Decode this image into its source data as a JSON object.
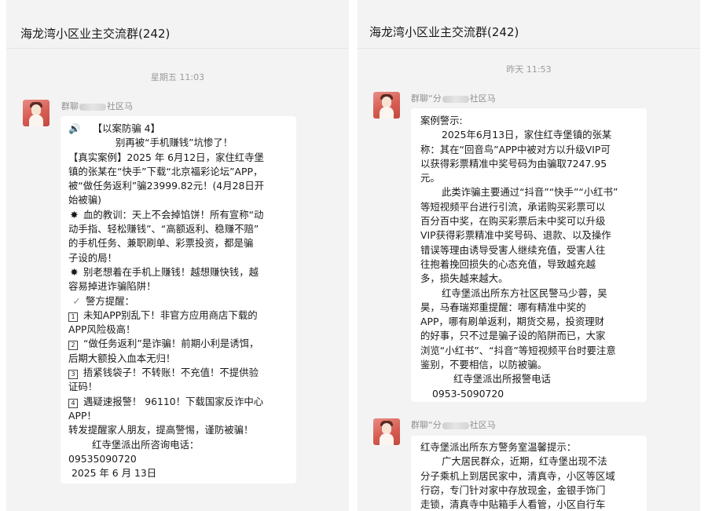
{
  "left": {
    "chat_title": "海龙湾小区业主交流群(242)",
    "timestamp": "星期五 11:03",
    "sender": {
      "prefix": "群聊",
      "suffix": "社区马"
    },
    "icons": {
      "speaker": "🔊",
      "virus": "✸",
      "check": "✓"
    },
    "message": {
      "l1": "【以案防骗 4】",
      "l2": "别再被“手机赚钱”坑惨了！",
      "l3": "【真实案例】2025 年 6月12日，家住红寺堡",
      "l4": "镇的张某在“快手”下载“北京福彩论坛”APP，",
      "l5": "被“做任务返利”骗23999.82元！(4月28日开",
      "l6": "始被骗)",
      "l7": "血的教训：天上不会掉馅饼！所有宣称“动",
      "l8": "动手指、轻松赚钱”、“高额返利、稳赚不赔”",
      "l9": "的手机任务、兼职刷单、彩票投资，都是骗",
      "l10": "子设的局！",
      "l11": "别老想着在手机上赚钱！越想赚快钱，越",
      "l12": "容易掉进诈骗陷阱！",
      "l13": "警方提醒：",
      "n1": "1",
      "l14": "未知APP别乱下！非官方应用商店下载的",
      "l15": "APP风险极高！",
      "n2": "2",
      "l16": "“做任务返利”是诈骗！前期小利是诱饵，",
      "l17": "后期大额投入血本无归！",
      "n3": "3",
      "l18": "捂紧钱袋子！不转账！不充值！不提供验",
      "l19": "证码！",
      "n4": "4",
      "l20": "遇疑速报警！ 96110！下载国家反诈中心",
      "l21": "APP！",
      "l22": "转发提醒家人朋友，提高警惕，谨防被骗！",
      "l23": "红寺堡派出所咨询电话：",
      "l24": "09535090720",
      "l25": "2025 年 6 月 13日"
    }
  },
  "right": {
    "chat_title": "海龙湾小区业主交流群(242)",
    "timestamp": "昨天 11:53",
    "sender1": {
      "prefix": "群聊“分",
      "suffix": "社区马"
    },
    "sender2": {
      "prefix": "群聊“分",
      "suffix": "社区马"
    },
    "message1": {
      "l1": "案例警示:",
      "l2": "2025年6月13日，家住红寺堡镇的张某",
      "l3": "称：其在“回音鸟”APP中被对方以升级VIP可",
      "l4": "以获得彩票精准中奖号码为由骗取7247.95",
      "l5": "元。",
      "l6": "此类诈骗主要通过“抖音”“快手”“小红书”",
      "l7": "等短视频平台进行引流，承诺购买彩票可以",
      "l8": "百分百中奖，在购买彩票后未中奖可以升级",
      "l9": "VIP获得彩票精准中奖号码、退款、以及操作",
      "l10": "错误等理由诱导受害人继续充值，受害人往",
      "l11": "往抱着挽回损失的心态充值，导致越充越",
      "l12": "多，损失越来越大。",
      "l13": "红寺堡派出所东方社区民警马少蓉，吴",
      "l14": "昊，马春瑞郑重提醒：哪有精准中奖的",
      "l15": "APP，哪有刷单返利，期货交易，投资理财",
      "l16": "的好事，只不过是骗子设的陷阱而已，大家",
      "l17": "浏览“小红书”、“抖音”等短视频平台时要注意",
      "l18": "鉴别，不要相信，以防被骗。",
      "l19": "红寺堡派出所报警电话",
      "l20": "0953-5090720"
    },
    "message2": {
      "l1": "红寺堡派出所东方警务室温馨提示：",
      "l2": "广大居民群众，近期，红寺堡出现不法",
      "l3": "分子乘机上到居民家中，清真寺，小区等区域",
      "l4": "行窃，专门针对家中存放现金，金银手饰门",
      "l5": "走锁，清真寺中贴箱手人看管，小区自行车"
    }
  }
}
